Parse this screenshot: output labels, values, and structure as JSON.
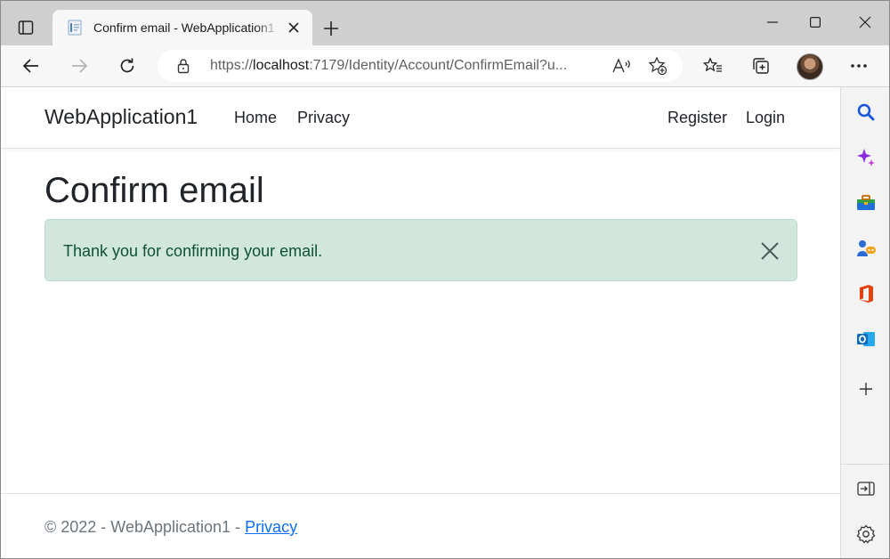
{
  "browser": {
    "tab": {
      "title": "Confirm email - WebApplication1",
      "close_icon": "close-icon"
    },
    "address_bar": {
      "url_prefix": "https://",
      "url_host": "localhost",
      "url_rest": ":7179/Identity/Account/ConfirmEmail?u..."
    },
    "read_aloud_label": "A⁾",
    "colors": {
      "tabstrip": "#cfcfcf",
      "toolbar": "#f7f7f7",
      "sidebar": "#f3f3f3"
    },
    "sidebar_icons": [
      "search-icon",
      "copilot-icon",
      "tools-icon",
      "games-icon",
      "office-icon",
      "outlook-icon",
      "add-icon",
      "hide-sidebar-icon",
      "settings-icon"
    ]
  },
  "app": {
    "brand": "WebApplication1",
    "nav_left": [
      "Home",
      "Privacy"
    ],
    "nav_right": [
      "Register",
      "Login"
    ],
    "page_title": "Confirm email",
    "alert": {
      "message": "Thank you for confirming your email.",
      "type": "success",
      "bg_color": "#d1e7dd",
      "text_color": "#0f5132"
    },
    "footer": {
      "text": "© 2022 - WebApplication1 - ",
      "link": "Privacy"
    }
  }
}
